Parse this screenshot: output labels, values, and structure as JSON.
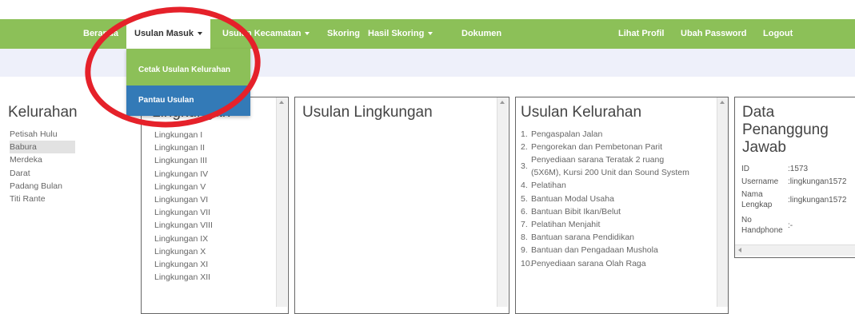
{
  "nav": {
    "beranda": "Beranda",
    "usulan_masuk": "Usulan Masuk",
    "usulan_kecamatan": "Usulan Kecamatan",
    "skoring": "Skoring",
    "hasil_skoring": "Hasil Skoring",
    "dokumen": "Dokumen",
    "lihat_profil": "Lihat Profil",
    "ubah_password": "Ubah Password",
    "logout": "Logout"
  },
  "dropdown": {
    "items": [
      {
        "label": "Cetak Usulan Kelurahan",
        "selected": false
      },
      {
        "label": "Pantau Usulan",
        "selected": true
      }
    ]
  },
  "kelurahan": {
    "title": "Kelurahan",
    "items": [
      "Petisah Hulu",
      "Babura",
      "Merdeka",
      "Darat",
      "Padang Bulan",
      "Titi Rante"
    ],
    "selected": "Babura"
  },
  "lingkungan": {
    "title": "Lingkungan",
    "items": [
      "Lingkungan I",
      "Lingkungan II",
      "Lingkungan III",
      "Lingkungan IV",
      "Lingkungan V",
      "Lingkungan VI",
      "Lingkungan VII",
      "Lingkungan VIII",
      "Lingkungan IX",
      "Lingkungan X",
      "Lingkungan XI",
      "Lingkungan XII"
    ]
  },
  "usulan_lingkungan": {
    "title": "Usulan Lingkungan"
  },
  "usulan_kelurahan": {
    "title": "Usulan Kelurahan",
    "items": [
      {
        "num": "1.",
        "text": "Pengaspalan Jalan"
      },
      {
        "num": "2.",
        "text": "Pengorekan dan Pembetonan Parit"
      },
      {
        "num": "3.",
        "text": "Penyediaan sarana Teratak 2 ruang",
        "text2": "(5X6M), Kursi 200 Unit dan Sound System"
      },
      {
        "num": "4.",
        "text": "Pelatihan"
      },
      {
        "num": "5.",
        "text": "Bantuan Modal Usaha"
      },
      {
        "num": "6.",
        "text": "Bantuan Bibit Ikan/Belut"
      },
      {
        "num": "7.",
        "text": "Pelatihan Menjahit"
      },
      {
        "num": "8.",
        "text": "Bantuan sarana Pendidikan"
      },
      {
        "num": "9.",
        "text": "Bantuan dan Pengadaan Mushola"
      },
      {
        "num": "10.",
        "text": "Penyediaan sarana Olah Raga"
      }
    ]
  },
  "penanggung_jawab": {
    "title_line1": "Data",
    "title_line2": "Penanggung",
    "title_line3": "Jawab",
    "id_label": "ID",
    "id_value": ":1573",
    "username_label": "Username",
    "username_value": ":lingkungan1572",
    "nama_label1": "Nama",
    "nama_label2": "Lengkap",
    "nama_value": ":lingkungan1572",
    "hp_label1": "No",
    "hp_label2": "Handphone",
    "hp_value": ":-"
  },
  "colors": {
    "navbar": "#8cc058",
    "selected_item": "#337ab7",
    "annotation": "#e5212a"
  }
}
